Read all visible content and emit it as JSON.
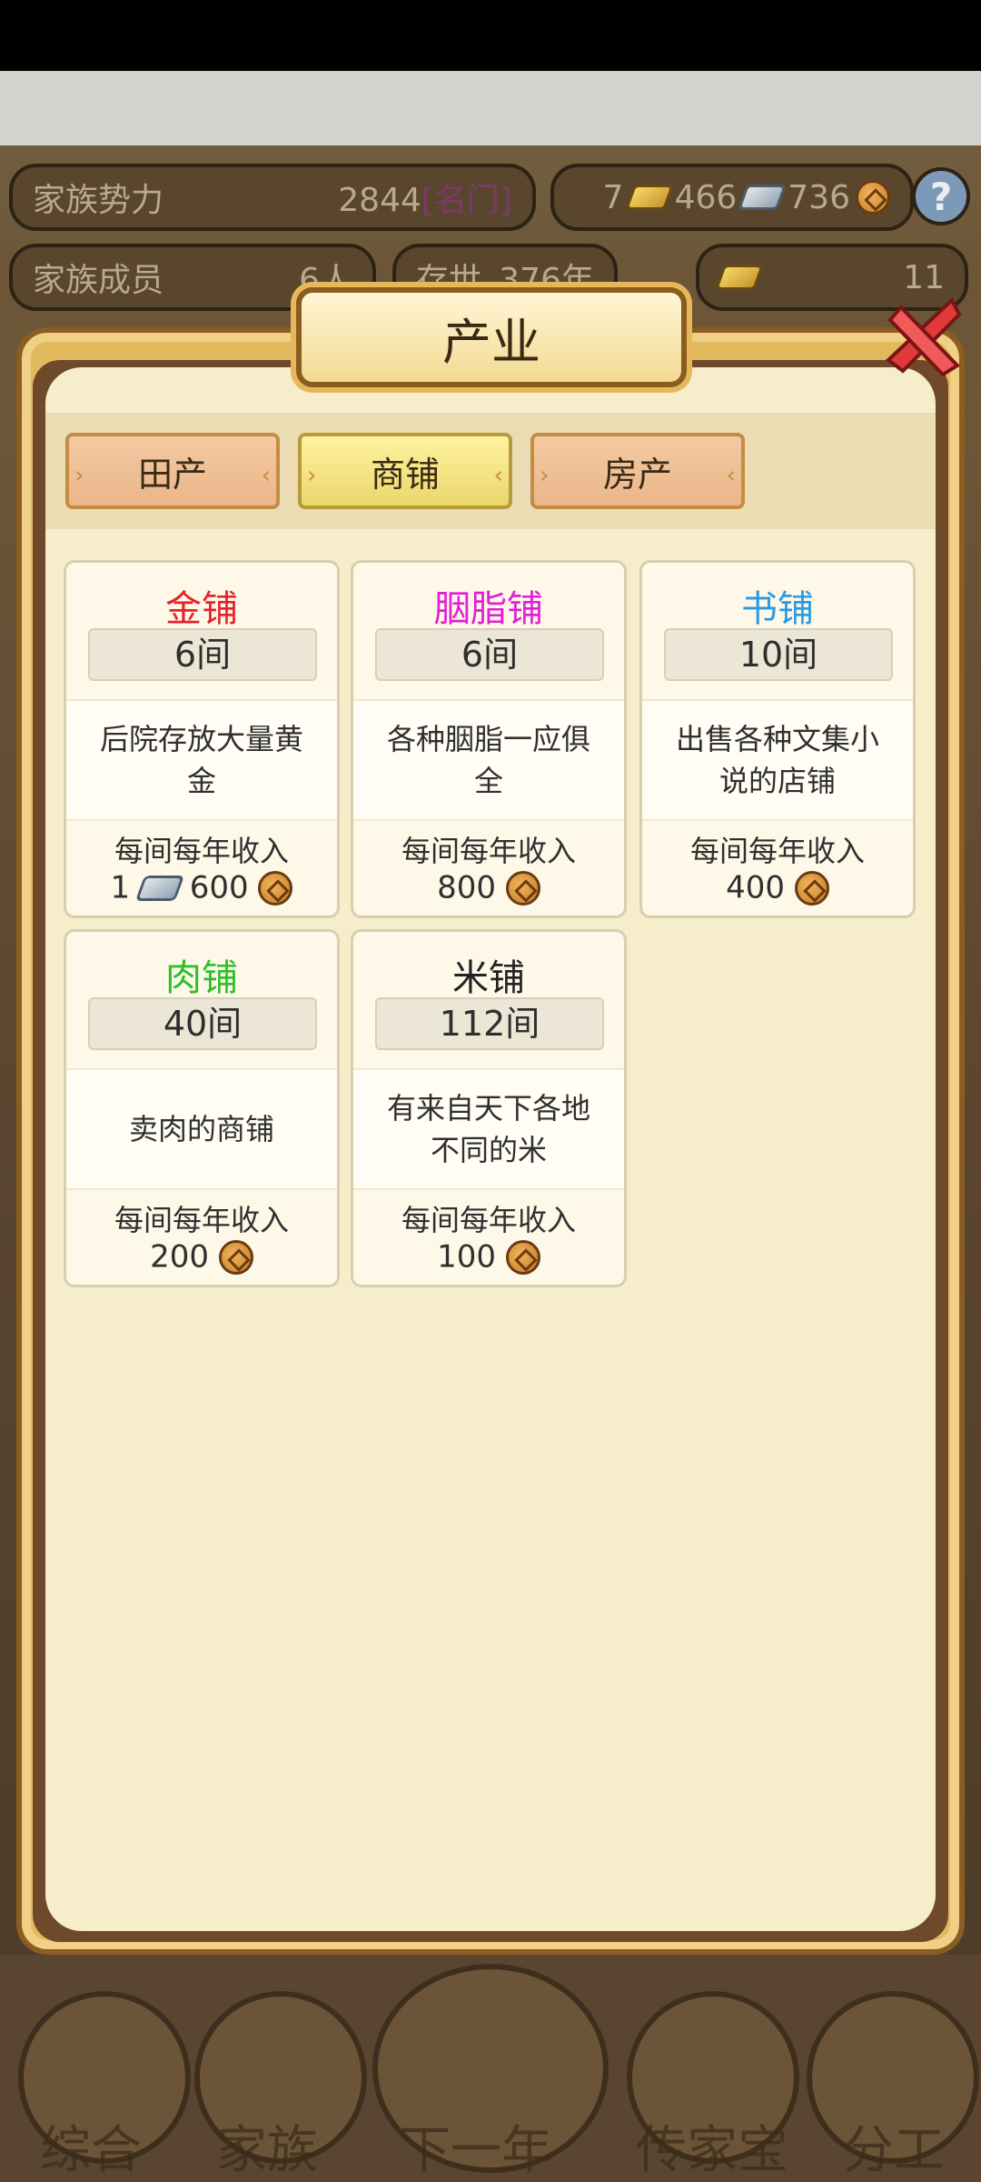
{
  "hud": {
    "power_label": "家族势力",
    "power_value": "2844",
    "power_rank": "[名门]",
    "gold": "7",
    "silver": "466",
    "coins": "736",
    "help": "?",
    "members_label": "家族成员",
    "members_value": "6人",
    "age_label": "存世",
    "age_value": "376年",
    "yuanbao": "11"
  },
  "panel": {
    "title": "产业",
    "tabs": [
      {
        "label": "田产",
        "active": false
      },
      {
        "label": "商铺",
        "active": true
      },
      {
        "label": "房产",
        "active": false
      }
    ],
    "shops": [
      {
        "name": "金铺",
        "color": "#e8202a",
        "count": "6间",
        "desc": "后院存放大量黄金",
        "income_label": "每间每年收入",
        "income_silver": "1",
        "income_coin": "600"
      },
      {
        "name": "胭脂铺",
        "color": "#e21fd6",
        "count": "6间",
        "desc": "各种胭脂一应俱全",
        "income_label": "每间每年收入",
        "income_coin": "800"
      },
      {
        "name": "书铺",
        "color": "#2a9ae3",
        "count": "10间",
        "desc": "出售各种文集小说的店铺",
        "income_label": "每间每年收入",
        "income_coin": "400"
      },
      {
        "name": "肉铺",
        "color": "#2fbf2a",
        "count": "40间",
        "desc": "卖肉的商铺",
        "income_label": "每间每年收入",
        "income_coin": "200"
      },
      {
        "name": "米铺",
        "color": "#222222",
        "count": "112间",
        "desc": "有来自天下各地不同的米",
        "income_label": "每间每年收入",
        "income_coin": "100"
      }
    ]
  },
  "nav": {
    "items": [
      "综合",
      "家族",
      "下一年",
      "传家宝",
      "分工"
    ]
  }
}
